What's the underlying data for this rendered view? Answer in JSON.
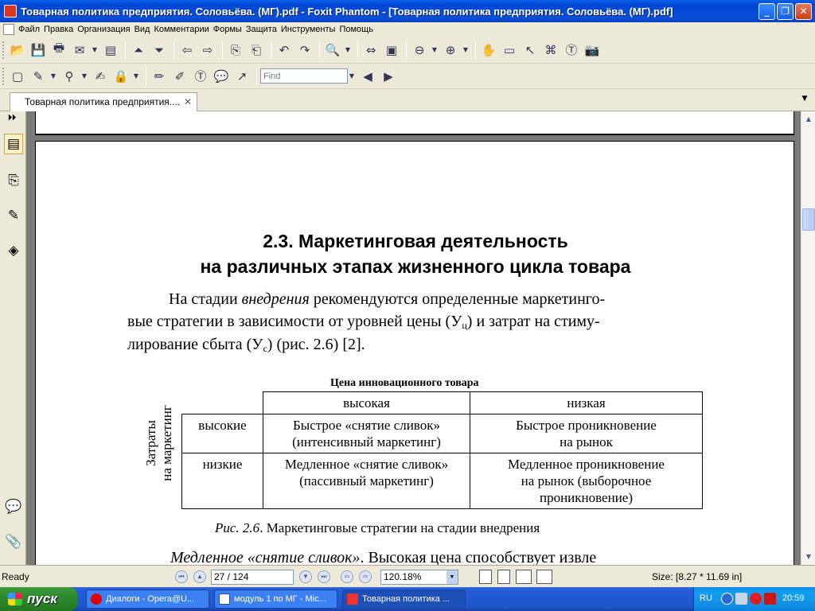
{
  "window": {
    "title": "Товарная политика предприятия. Соловьёва. (МГ).pdf - Foxit Phantom - [Товарная политика предприятия. Соловьёва. (МГ).pdf]",
    "minimize": "_",
    "maximize": "❐",
    "close": "✕"
  },
  "menu": [
    "Файл",
    "Правка",
    "Организация",
    "Вид",
    "Комментарии",
    "Формы",
    "Защита",
    "Инструменты",
    "Помощь"
  ],
  "toolbar2": {
    "find_placeholder": "Find"
  },
  "tabs": {
    "doc_tab_label": "Товарная политика предприятия....",
    "close": "✕",
    "menu": "▼"
  },
  "nav": {
    "toggle": "⏵⏵"
  },
  "document": {
    "heading_line1": "2.3. Маркетинговая деятельность",
    "heading_line2": "на различных этапах жизненного цикла товара",
    "para1_a": "На стадии ",
    "para1_italic": "внедрения",
    "para1_b": " рекомендуются определенные маркетинго-",
    "para2_a": "вые стратегии в зависимости от уровней цены (У",
    "para2_sub": "ц",
    "para2_b": ") и затрат на стиму-",
    "para3_a": "лирование сбыта (У",
    "para3_sub": "с",
    "para3_b": ") (рис. 2.6) [2].",
    "table_title": "Цена инновационного товара",
    "axis_label_line1": "Затраты",
    "axis_label_line2": "на маркетинг",
    "col_high": "высокая",
    "col_low": "низкая",
    "row_high": "высокие",
    "row_low": "низкие",
    "cell_hh_1": "Быстрое «снятие сливок»",
    "cell_hh_2": "(интенсивный маркетинг)",
    "cell_hl_1": "Быстрое проникновение",
    "cell_hl_2": "на рынок",
    "cell_lh_1": "Медленное «снятие сливок»",
    "cell_lh_2": "(пассивный маркетинг)",
    "cell_ll_1": "Медленное проникновение",
    "cell_ll_2": "на рынок (выборочное",
    "cell_ll_3": "проникновение)",
    "fig_caption_italic": "Рис. 2.6",
    "fig_caption_rest": ". Маркетинговые стратегии на стадии внедрения",
    "para4_italic": "Медленное «снятие сливок»",
    "para4_rest": ". Высокая цена способствует извле"
  },
  "status": {
    "ready": "Ready",
    "page_indicator": "27 / 124",
    "zoom": "120.18%",
    "page_size": "Size: [8.27 * 11.69 in]"
  },
  "taskbar": {
    "start": "пуск",
    "tasks": [
      "Диалоги - Opera@U...",
      "модуль 1 по МГ - Mic...",
      "Товарная политика ..."
    ],
    "lang": "RU",
    "clock": "20:59"
  }
}
